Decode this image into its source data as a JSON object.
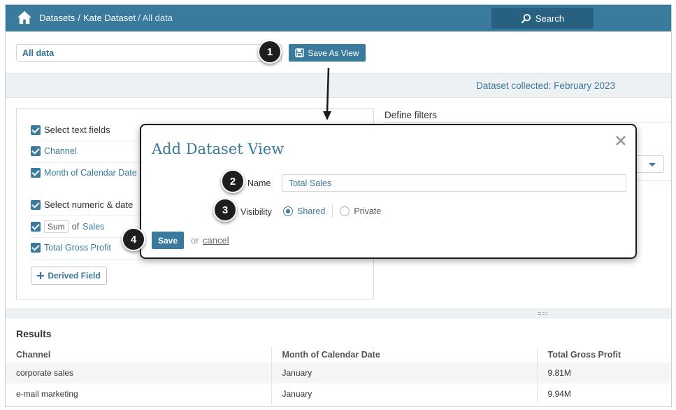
{
  "header": {
    "breadcrumbs": [
      "Datasets",
      "Kate Dataset"
    ],
    "breadcrumb_separator": "/",
    "current": "/ All data",
    "search_label": "Search"
  },
  "view_bar": {
    "view_name": "All data",
    "save_as_view_label": "Save As View"
  },
  "dataset_collected": "Dataset collected: February 2023",
  "left_panel": {
    "text_fields_label": "Select text fields",
    "text_fields": [
      "Channel",
      "Month of Calendar Date"
    ],
    "numeric_fields_label": "Select numeric & date",
    "aggregate": "Sum",
    "aggregate_of": "of",
    "aggregate_field": "Sales",
    "numeric_fields": [
      "Total Gross Profit"
    ],
    "derived_field_label": "Derived Field"
  },
  "filters": {
    "title": "Define filters"
  },
  "dialog": {
    "title": "Add Dataset View",
    "name_label": "Name",
    "name_value": "Total Sales",
    "visibility_label": "Visibility",
    "visibility_options": [
      {
        "label": "Shared",
        "selected": true
      },
      {
        "label": "Private",
        "selected": false
      }
    ],
    "save_label": "Save",
    "or_text": "or",
    "cancel_label": "cancel"
  },
  "markers": [
    "1",
    "2",
    "3",
    "4"
  ],
  "results": {
    "title": "Results",
    "columns": [
      "Channel",
      "Month of Calendar Date",
      "Total Gross Profit"
    ],
    "rows": [
      [
        "corporate sales",
        "January",
        "9.81M"
      ],
      [
        "e-mail marketing",
        "January",
        "9.94M"
      ]
    ]
  },
  "colors": {
    "primary": "#3a7b9d",
    "primary_dark": "#27617f",
    "marker": "#1e1e1e"
  }
}
